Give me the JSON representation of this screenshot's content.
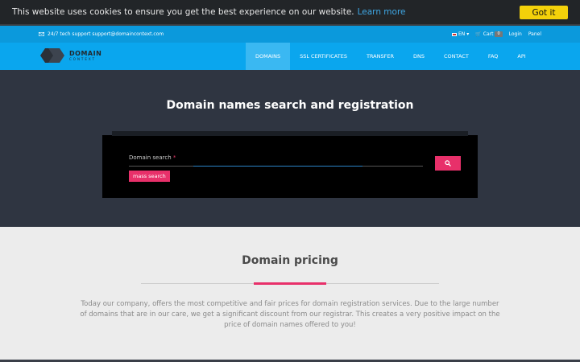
{
  "cookie": {
    "message": "This website uses cookies to ensure you get the best experience on our website.",
    "learn_more": "Learn more",
    "got_it": "Got it"
  },
  "topbar": {
    "support": "24/7 tech support support@domaincontext.com",
    "language": "EN",
    "cart_label": "Cart",
    "cart_count": "0",
    "login": "Login",
    "panel": "Panel"
  },
  "logo": {
    "name": "DOMAIN",
    "tagline": "CONTEXT"
  },
  "nav": {
    "items": [
      {
        "label": "DOMAINS"
      },
      {
        "label": "SSL CERTIFICATES"
      },
      {
        "label": "TRANSFER"
      },
      {
        "label": "DNS"
      },
      {
        "label": "CONTACT"
      },
      {
        "label": "FAQ"
      },
      {
        "label": "API"
      }
    ]
  },
  "hero": {
    "title": "Domain names search and registration",
    "search_label": "Domain search",
    "required_mark": "*",
    "mass_search": "mass search"
  },
  "pricing": {
    "title": "Domain pricing",
    "text": "Today our company, offers the most competitive and fair prices for domain registration services. Due to the large number of domains that are in our care, we get a significant discount from our registrar. This creates a very positive impact on the price of domain names offered to you!"
  },
  "colors": {
    "accent": "#e8306a",
    "nav": "#0aa6ee",
    "topbar": "#0b99dc",
    "hero": "#2f3541",
    "cookie_button": "#f3d10a"
  }
}
